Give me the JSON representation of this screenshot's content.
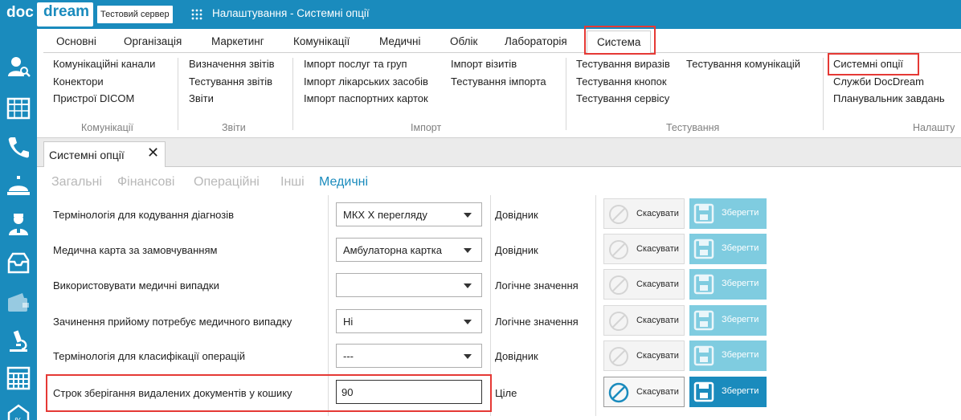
{
  "app": {
    "logo_part1": "doc",
    "logo_part2": "dream",
    "server_badge": "Тестовий сервер",
    "window_title": "Налаштування - Системні опції"
  },
  "rail_icons": [
    "user-search-icon",
    "calendar-grid-icon",
    "phone-icon",
    "reception-bell-icon",
    "doctor-icon",
    "inbox-icon",
    "wallet-icon",
    "microscope-icon",
    "schedule-grid-icon",
    "discount-icon"
  ],
  "ribbon": {
    "tabs": [
      "Основні",
      "Організація",
      "Маркетинг",
      "Комунікації",
      "Медичні",
      "Облік",
      "Лабораторія",
      "Система"
    ],
    "active_tab": "Система",
    "groups": [
      {
        "label": "Комунікації",
        "columns": [
          [
            "Комунікаційні канали",
            "Конектори",
            "Пристрої DICOM"
          ]
        ]
      },
      {
        "label": "Звіти",
        "columns": [
          [
            "Визначення звітів",
            "Тестування звітів",
            "Звіти"
          ]
        ]
      },
      {
        "label": "Імпорт",
        "columns": [
          [
            "Імпорт послуг та груп",
            "Імпорт лікарських засобів",
            "Імпорт паспортних карток"
          ],
          [
            "Імпорт візитів",
            "Тестування імпорта"
          ]
        ]
      },
      {
        "label": "Тестування",
        "columns": [
          [
            "Тестування виразів",
            "Тестування кнопок",
            "Тестування сервісу"
          ],
          [
            "Тестування комунікацій"
          ]
        ]
      },
      {
        "label": "Налашту",
        "columns": [
          [
            "Системні опції",
            "Служби DocDream",
            "Планувальник завдань"
          ]
        ]
      }
    ]
  },
  "document_tab": {
    "title": "Системні опції",
    "close_glyph": "✕"
  },
  "subtabs": [
    "Загальні",
    "Фінансові",
    "Операційні",
    "Інші",
    "Медичні"
  ],
  "active_subtab": "Медичні",
  "options": [
    {
      "name": "Термінологія для кодування діагнозів",
      "control": "select",
      "value": "МКХ X перегляду",
      "type": "Довідник",
      "enabled": false
    },
    {
      "name": "Медична карта за замовчуванням",
      "control": "select",
      "value": "Амбулаторна картка",
      "type": "Довідник",
      "enabled": false
    },
    {
      "name": "Використовувати медичні випадки",
      "control": "select",
      "value": "",
      "type": "Логічне значення",
      "enabled": false
    },
    {
      "name": "Зачинення прийому потребує медичного випадку",
      "control": "select",
      "value": "Ні",
      "type": "Логічне значення",
      "enabled": false
    },
    {
      "name": "Термінологія для класифікації операцій",
      "control": "select",
      "value": "---",
      "type": "Довідник",
      "enabled": false
    },
    {
      "name": "Строк зберігання видалених документів у кошику",
      "control": "text",
      "value": "90",
      "type": "Ціле",
      "enabled": true
    }
  ],
  "buttons": {
    "cancel": "Скасувати",
    "save": "Зберегти"
  },
  "colors": {
    "brand": "#1a8bbd",
    "save_disabled": "#7fcce0",
    "highlight": "#e53935"
  }
}
